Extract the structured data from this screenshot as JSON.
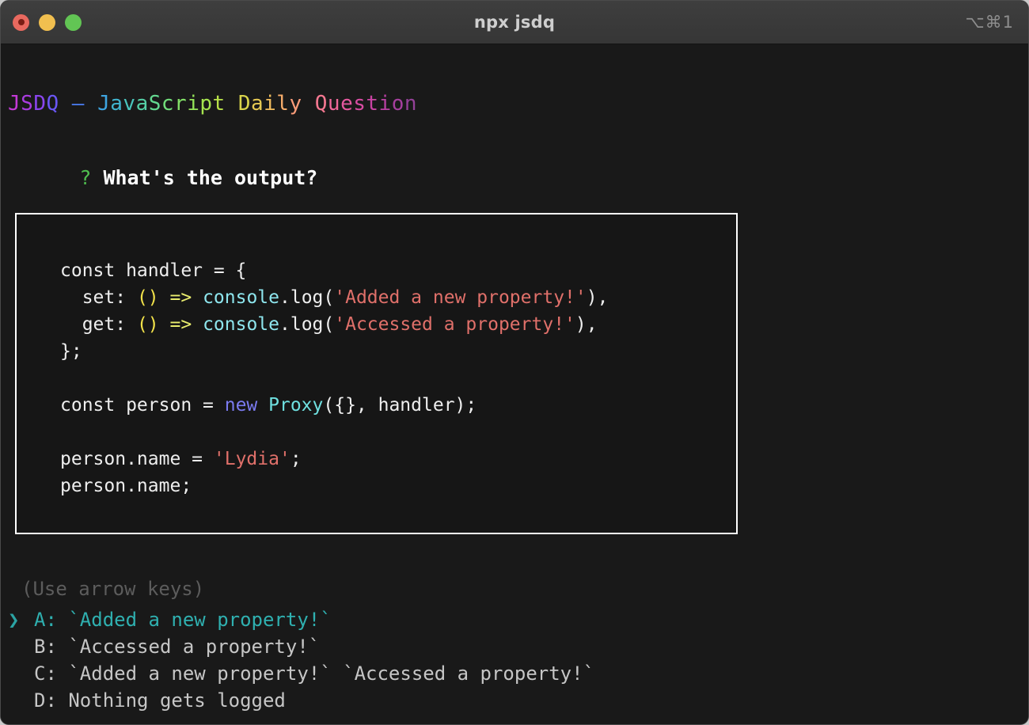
{
  "window": {
    "title": "npx jsdq",
    "shortcut": "⌥⌘1",
    "traffic_lights": [
      {
        "name": "close",
        "color": "#e9695f"
      },
      {
        "name": "minimize",
        "color": "#f1bf4f"
      },
      {
        "name": "maximize",
        "color": "#62c554"
      }
    ]
  },
  "banner": {
    "text": "JSDQ — JavaScript Daily Question",
    "chars": [
      {
        "c": "J",
        "color": "#c239d6"
      },
      {
        "c": "S",
        "color": "#a93ce0"
      },
      {
        "c": "D",
        "color": "#8a45ee"
      },
      {
        "c": "Q",
        "color": "#6a56f4"
      },
      {
        "c": " ",
        "color": "#5a6af6"
      },
      {
        "c": "—",
        "color": "#4a7df3"
      },
      {
        "c": " ",
        "color": "#4191ec"
      },
      {
        "c": "J",
        "color": "#3ea4e0"
      },
      {
        "c": "a",
        "color": "#41b5d0"
      },
      {
        "c": "v",
        "color": "#49c4bc"
      },
      {
        "c": "a",
        "color": "#55cfa6"
      },
      {
        "c": "S",
        "color": "#63d890"
      },
      {
        "c": "c",
        "color": "#72de7b"
      },
      {
        "c": "r",
        "color": "#83e268"
      },
      {
        "c": "i",
        "color": "#94e459"
      },
      {
        "c": "p",
        "color": "#a6e44e"
      },
      {
        "c": "t",
        "color": "#b8e148"
      },
      {
        "c": " ",
        "color": "#c9dc47"
      },
      {
        "c": "D",
        "color": "#d9d44b"
      },
      {
        "c": "a",
        "color": "#e6c953"
      },
      {
        "c": "i",
        "color": "#f0bc5e"
      },
      {
        "c": "l",
        "color": "#f7ad6b"
      },
      {
        "c": "y",
        "color": "#fb9c79"
      },
      {
        "c": " ",
        "color": "#fa8a86"
      },
      {
        "c": "Q",
        "color": "#f67891"
      },
      {
        "c": "u",
        "color": "#ef6799"
      },
      {
        "c": "e",
        "color": "#e5589f"
      },
      {
        "c": "s",
        "color": "#d84ca2"
      },
      {
        "c": "t",
        "color": "#c944a3"
      },
      {
        "c": "i",
        "color": "#b840a2"
      },
      {
        "c": "o",
        "color": "#a63f9e"
      },
      {
        "c": "n",
        "color": "#944198"
      }
    ]
  },
  "question": {
    "marker": "?",
    "marker_color": "#4fbf4f",
    "text": "What's the output?"
  },
  "code": {
    "lines": [
      [
        {
          "t": "const handler = {",
          "k": "plain"
        }
      ],
      [
        {
          "t": "  set: ",
          "k": "plain"
        },
        {
          "t": "()",
          "k": "paren"
        },
        {
          "t": " ",
          "k": "plain"
        },
        {
          "t": "=>",
          "k": "arrow"
        },
        {
          "t": " ",
          "k": "plain"
        },
        {
          "t": "console",
          "k": "obj"
        },
        {
          "t": ".log(",
          "k": "plain"
        },
        {
          "t": "'Added a new property!'",
          "k": "str"
        },
        {
          "t": "),",
          "k": "plain"
        }
      ],
      [
        {
          "t": "  get: ",
          "k": "plain"
        },
        {
          "t": "()",
          "k": "paren"
        },
        {
          "t": " ",
          "k": "plain"
        },
        {
          "t": "=>",
          "k": "arrow"
        },
        {
          "t": " ",
          "k": "plain"
        },
        {
          "t": "console",
          "k": "obj"
        },
        {
          "t": ".log(",
          "k": "plain"
        },
        {
          "t": "'Accessed a property!'",
          "k": "str"
        },
        {
          "t": "),",
          "k": "plain"
        }
      ],
      [
        {
          "t": "};",
          "k": "plain"
        }
      ],
      [],
      [
        {
          "t": "const person = ",
          "k": "plain"
        },
        {
          "t": "new",
          "k": "kw"
        },
        {
          "t": " ",
          "k": "plain"
        },
        {
          "t": "Proxy",
          "k": "cls"
        },
        {
          "t": "({}, handler);",
          "k": "plain"
        }
      ],
      [],
      [
        {
          "t": "person.name = ",
          "k": "plain"
        },
        {
          "t": "'Lydia'",
          "k": "str"
        },
        {
          "t": ";",
          "k": "plain"
        }
      ],
      [
        {
          "t": "person.name;",
          "k": "plain"
        }
      ]
    ]
  },
  "prompt": {
    "hint": "(Use arrow keys)",
    "pointer": "❯",
    "selected_index": 0,
    "selected_color": "#2fb0b0",
    "normal_color": "#c6c6c6",
    "options": [
      {
        "key": "A",
        "label": "A: `Added a new property!`"
      },
      {
        "key": "B",
        "label": "B: `Accessed a property!`"
      },
      {
        "key": "C",
        "label": "C: `Added a new property!` `Accessed a property!`"
      },
      {
        "key": "D",
        "label": "D: Nothing gets logged"
      }
    ]
  }
}
